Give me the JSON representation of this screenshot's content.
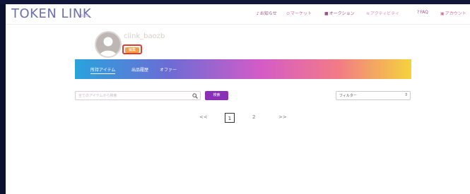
{
  "header": {
    "logo_text": "TOKEN LINK",
    "logo_badge": "Beta",
    "nav": [
      {
        "icon": "bell-icon",
        "label": "お知らせ"
      },
      {
        "icon": "store-icon",
        "label": "マーケット"
      },
      {
        "icon": "gavel-icon",
        "label": "オークション"
      },
      {
        "icon": "activity-icon",
        "label": "アクティビティ"
      },
      {
        "icon": "question-icon",
        "label": "FAQ"
      },
      {
        "icon": "user-icon",
        "label": "アカウント"
      }
    ]
  },
  "profile": {
    "username": "clink_baozb",
    "edit_label": "編集"
  },
  "tabs": [
    {
      "label": "所持アイテム",
      "active": true
    },
    {
      "label": "出品履歴",
      "active": false
    },
    {
      "label": "オファー",
      "active": false
    }
  ],
  "search": {
    "placeholder": "全てのアイテムから検索",
    "button_label": "検索"
  },
  "filter": {
    "label": "フィルター"
  },
  "pagination": {
    "prev": "<<",
    "pages": [
      "1",
      "2"
    ],
    "current": "1",
    "next": ">>"
  },
  "colors": {
    "accent_purple": "#8a2fb8",
    "edit_orange": "#f3a047",
    "highlight_red": "#e23b32"
  }
}
